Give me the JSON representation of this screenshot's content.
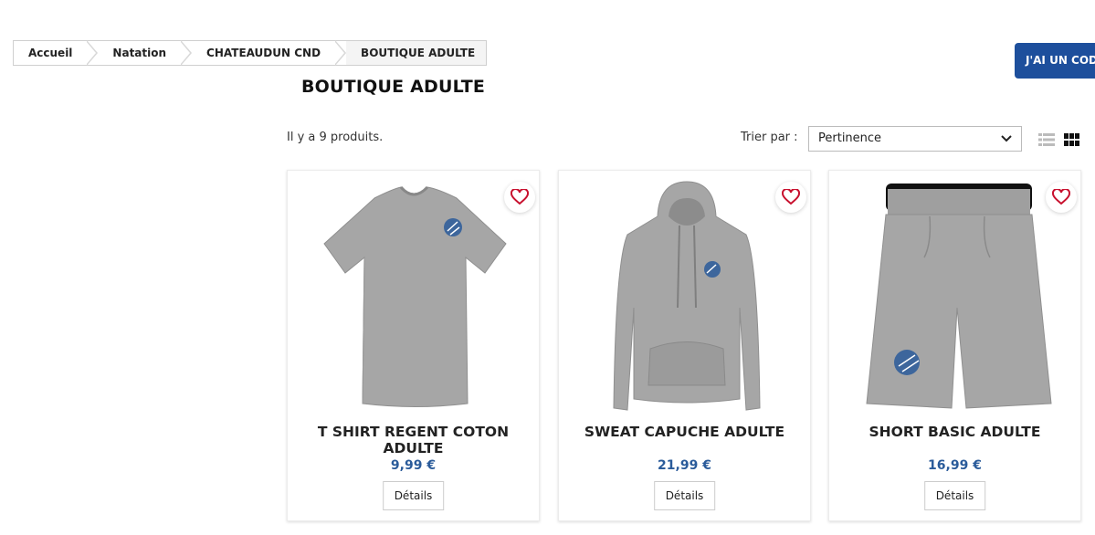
{
  "breadcrumb": {
    "items": [
      {
        "label": "Accueil"
      },
      {
        "label": "Natation"
      },
      {
        "label": "CHATEAUDUN CND"
      },
      {
        "label": "BOUTIQUE ADULTE"
      }
    ]
  },
  "header": {
    "code_button_label": "J'AI UN CODE",
    "page_title": "BOUTIQUE ADULTE"
  },
  "toolbar": {
    "product_count": "Il y a 9 produits.",
    "sort_label": "Trier par :",
    "sort_value": "Pertinence",
    "icons": [
      "list-view-icon",
      "grid-view-icon",
      "chevron-down-icon"
    ]
  },
  "products": [
    {
      "name": "T SHIRT REGENT COTON ADULTE",
      "price": "9,99 €",
      "details_label": "Détails"
    },
    {
      "name": "SWEAT CAPUCHE ADULTE",
      "price": "21,99 €",
      "details_label": "Détails"
    },
    {
      "name": "SHORT BASIC ADULTE",
      "price": "16,99 €",
      "details_label": "Détails"
    }
  ],
  "colors": {
    "accent": "#1d4f9c",
    "price": "#2a5b9a",
    "favorite": "#c8102e",
    "garment": "#a6a6a6"
  }
}
